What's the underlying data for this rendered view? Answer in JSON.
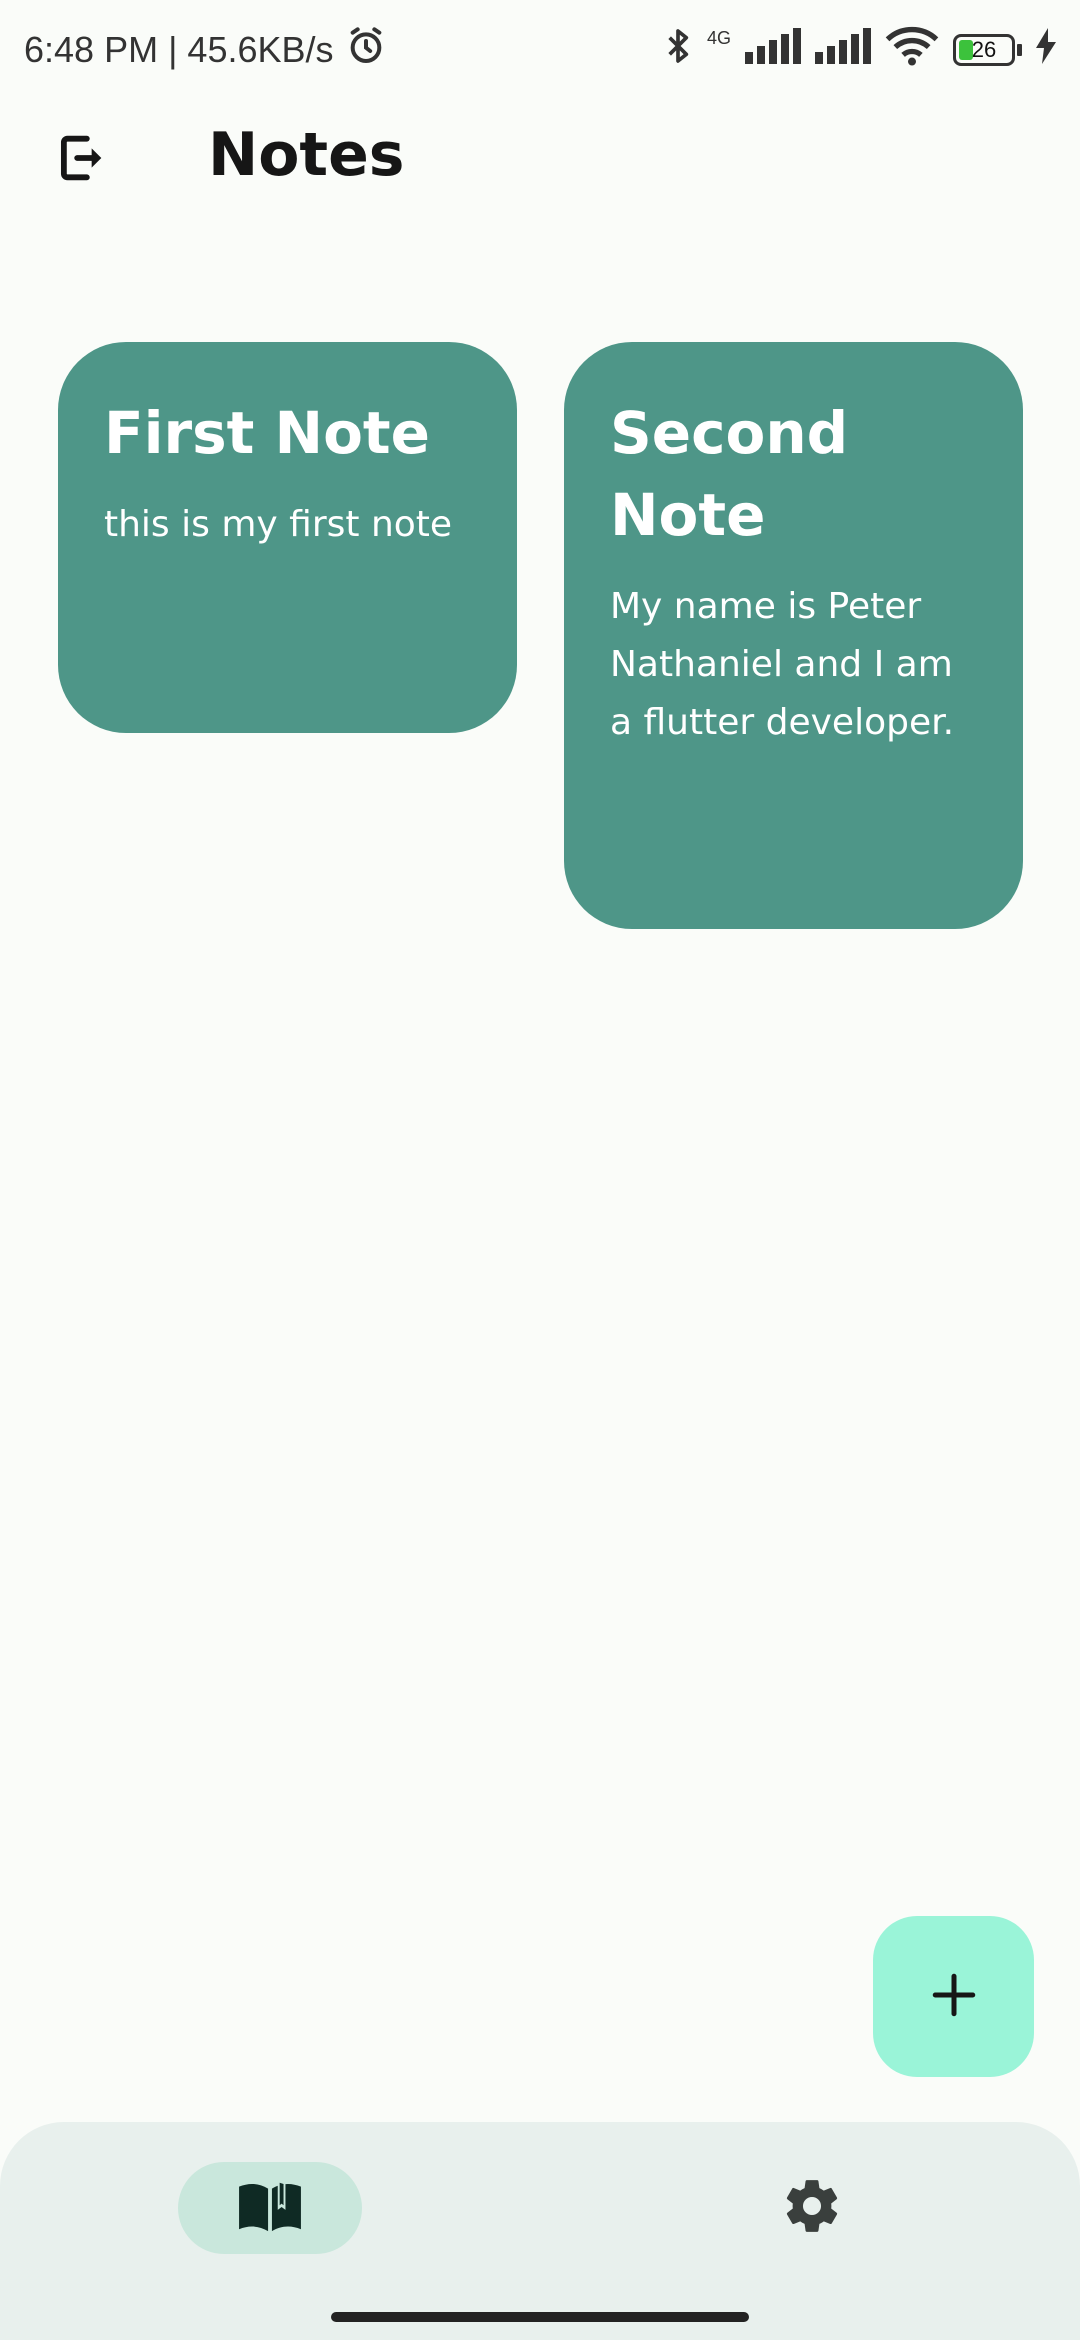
{
  "status_bar": {
    "time_speed": "6:48 PM | 45.6KB/s",
    "network_label": "4G",
    "battery_level": "26",
    "icons": [
      "alarm-icon",
      "bluetooth-icon",
      "signal-icon",
      "signal-icon",
      "wifi-icon",
      "battery-icon",
      "charging-icon"
    ]
  },
  "app_bar": {
    "title": "Notes",
    "logout_icon": "logout-icon"
  },
  "notes": [
    {
      "title": "First Note",
      "body": "this is my first note"
    },
    {
      "title": "Second Note",
      "body": "My name is Peter Nathaniel and I am a flutter developer."
    }
  ],
  "fab": {
    "icon": "plus-icon"
  },
  "bottom_nav": {
    "items": [
      {
        "icon": "book-icon",
        "selected": true
      },
      {
        "icon": "gear-icon",
        "selected": false
      }
    ]
  },
  "colors": {
    "background": "#fafcf9",
    "note_card": "#4e9688",
    "fab": "#9af4d8",
    "bottom_nav": "#e8f0ed",
    "nav_indicator": "#c9e7dc"
  }
}
